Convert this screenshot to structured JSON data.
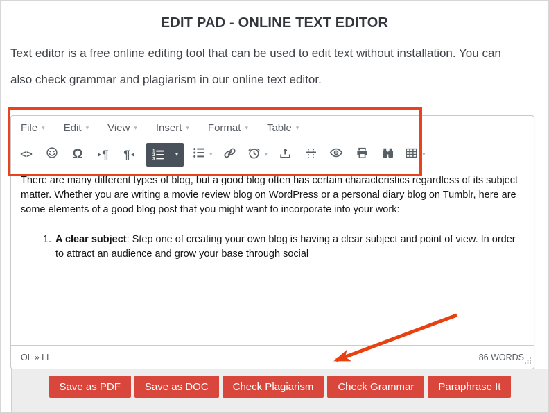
{
  "page": {
    "title": "EDIT PAD - ONLINE TEXT EDITOR",
    "intro_line1": "Text editor is a free online editing tool that can be used to edit text without installation. You can",
    "intro_line2": "also check grammar and plagiarism in our online text editor."
  },
  "glyphs": {
    "caret": "▾",
    "source_code": "<>",
    "omega": "Ω",
    "pilcrow": "¶"
  },
  "editor": {
    "menus": [
      {
        "label": "File"
      },
      {
        "label": "Edit"
      },
      {
        "label": "View"
      },
      {
        "label": "Insert"
      },
      {
        "label": "Format"
      },
      {
        "label": "Table"
      }
    ],
    "toolbar_icon_names": [
      "source-code",
      "emoticon",
      "special-character",
      "ltr-paragraph",
      "rtl-paragraph",
      "numbered-list",
      "bullet-list",
      "link",
      "clock",
      "upload",
      "page-break",
      "preview",
      "print",
      "find-replace",
      "table"
    ],
    "content": {
      "paragraph": "There are many different types of blog, but a good blog often has certain characteristics regardless of its subject matter. Whether you are writing a movie review blog on WordPress or a personal diary blog on Tumblr, here are some elements of a good blog post that you might want to incorporate into your work:",
      "list_item_bold": "A clear subject",
      "list_item_rest": ": Step one of creating your own blog is having a clear subject and point of view. In order to attract an audience and grow your base through social"
    },
    "statusbar": {
      "element_path": "OL » LI",
      "word_count": "86 WORDS"
    }
  },
  "actions": [
    {
      "label": "Save as PDF"
    },
    {
      "label": "Save as DOC"
    },
    {
      "label": "Check Plagiarism"
    },
    {
      "label": "Check Grammar"
    },
    {
      "label": "Paraphrase It"
    }
  ],
  "colors": {
    "action_button": "#d9473c",
    "active_tool_bg": "#49525a",
    "annotation": "#e8431c",
    "annotation_arrow": "#e8400f"
  }
}
